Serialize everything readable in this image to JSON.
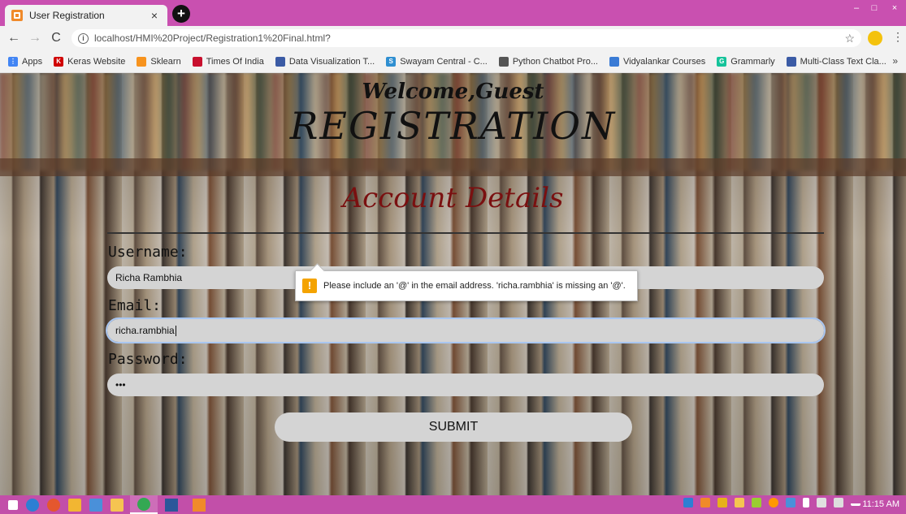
{
  "browser": {
    "tab_title": "User Registration",
    "tab_close": "×",
    "new_tab": "+",
    "url": "localhost/HMI%20Project/Registration1%20Final.html?",
    "window_controls": {
      "minimize": "–",
      "maximize": "□",
      "close": "×"
    }
  },
  "bookmarks": [
    {
      "label": "Apps",
      "icon_color": "#4285f4",
      "icon_char": "⋮"
    },
    {
      "label": "Keras Website",
      "icon_color": "#d00000",
      "icon_char": "K"
    },
    {
      "label": "Sklearn",
      "icon_color": "#f7931e",
      "icon_char": ""
    },
    {
      "label": "Times Of India",
      "icon_color": "#c8102e",
      "icon_char": ""
    },
    {
      "label": "Data Visualization T...",
      "icon_color": "#3b5ba5",
      "icon_char": ""
    },
    {
      "label": "Swayam Central - C...",
      "icon_color": "#2f8fd1",
      "icon_char": "S"
    },
    {
      "label": "Python Chatbot Pro...",
      "icon_color": "#555555",
      "icon_char": ""
    },
    {
      "label": "Vidyalankar Courses",
      "icon_color": "#3a7bd5",
      "icon_char": ""
    },
    {
      "label": "Grammarly",
      "icon_color": "#15c39a",
      "icon_char": "G"
    },
    {
      "label": "Multi-Class Text Cla...",
      "icon_color": "#3b5ba5",
      "icon_char": ""
    }
  ],
  "bookmarks_overflow": "»",
  "page": {
    "welcome": "Welcome,Guest",
    "title": "REGISTRATION",
    "section_title": "Account Details",
    "username_label": "Username:",
    "username_value": "Richa Rambhia",
    "email_label": "Email:",
    "email_value": "richa.rambhia",
    "password_label": "Password:",
    "password_value": "•••",
    "validation_message": "Please include an '@' in the email address. 'richa.rambhia' is missing an '@'.",
    "warning_glyph": "!",
    "submit_label": "SUBMIT"
  },
  "taskbar": {
    "clock": "11:15 AM",
    "colors": {
      "bar": "#c24fa9",
      "accent": "#c950b0"
    }
  }
}
